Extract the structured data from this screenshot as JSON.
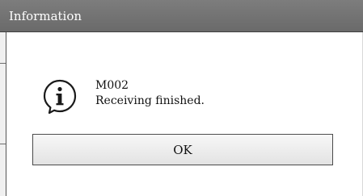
{
  "dialog": {
    "title": "Information",
    "icon": "info-bubble-icon",
    "message_code": "M002",
    "message_text": "Receiving finished.",
    "ok_label": "OK"
  },
  "colors": {
    "titlebar": "#707070",
    "title_text": "#ffffff",
    "background": "#ffffff",
    "button_border": "#4a4a4a"
  }
}
